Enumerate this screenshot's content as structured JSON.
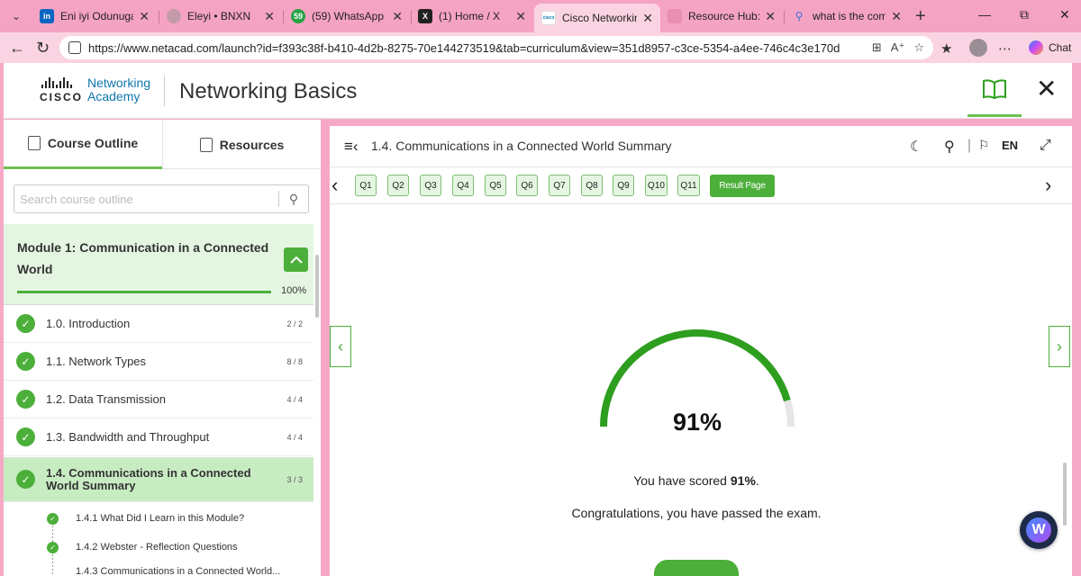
{
  "browser": {
    "tabs": [
      {
        "title": "Eni iyi Odunuga | Li",
        "favicon": "in",
        "favicon_color": "#0a66c2"
      },
      {
        "title": "Eleyi • BNXN",
        "favicon": "",
        "favicon_color": "#c49aa8"
      },
      {
        "title": "(59) WhatsApp",
        "favicon": "59",
        "favicon_color": "#25a244"
      },
      {
        "title": "(1) Home / X",
        "favicon": "X",
        "favicon_color": "#222222"
      },
      {
        "title": "Cisco Networking A",
        "favicon": "cisco",
        "favicon_color": "#ffffff",
        "active": true
      },
      {
        "title": "Resource Hub: Get",
        "favicon": "",
        "favicon_color": "#e98fb0"
      },
      {
        "title": "what is the commu",
        "favicon": "Q",
        "favicon_color": "#3b6fd8"
      }
    ],
    "url": "https://www.netacad.com/launch?id=f393c38f-b410-4d2b-8275-70e144273519&tab=curriculum&view=351d8957-c3ce-5354-a4ee-746c4c3e170d",
    "chat_label": "Chat"
  },
  "header": {
    "brand_line1": "Networking",
    "brand_line2": "Academy",
    "cisco_word": "CISCO",
    "course_title": "Networking Basics"
  },
  "sidebar": {
    "tab_outline": "Course Outline",
    "tab_resources": "Resources",
    "search_placeholder": "Search course outline",
    "module": {
      "title": "Module 1: Communication in a Connected World",
      "progress": 1.0,
      "progress_label": "100%"
    },
    "items": [
      {
        "label": "1.0. Introduction",
        "count": "2 / 2"
      },
      {
        "label": "1.1. Network Types",
        "count": "8 / 8"
      },
      {
        "label": "1.2. Data Transmission",
        "count": "4 / 4"
      },
      {
        "label": "1.3. Bandwidth and Throughput",
        "count": "4 / 4"
      },
      {
        "label": "1.4. Communications in a Connected World Summary",
        "count": "3 / 3",
        "active": true
      }
    ],
    "sub_items": [
      {
        "label": "1.4.1 What Did I Learn in this Module?"
      },
      {
        "label": "1.4.2 Webster - Reflection Questions"
      },
      {
        "label": "1.4.3 Communications in a Connected World..."
      }
    ]
  },
  "main": {
    "lesson_title": "1.4. Communications in a Connected World Summary",
    "language": "EN",
    "questions": [
      "Q1",
      "Q2",
      "Q3",
      "Q4",
      "Q5",
      "Q6",
      "Q7",
      "Q8",
      "Q9",
      "Q10",
      "Q11"
    ],
    "result_label": "Result Page",
    "score": 0.91,
    "score_display": "91%",
    "score_text_prefix": "You have scored ",
    "score_text_value": "91%",
    "score_text_suffix": ".",
    "congrats": "Congratulations, you have passed the exam.",
    "accent_color": "#2e9e1f"
  }
}
